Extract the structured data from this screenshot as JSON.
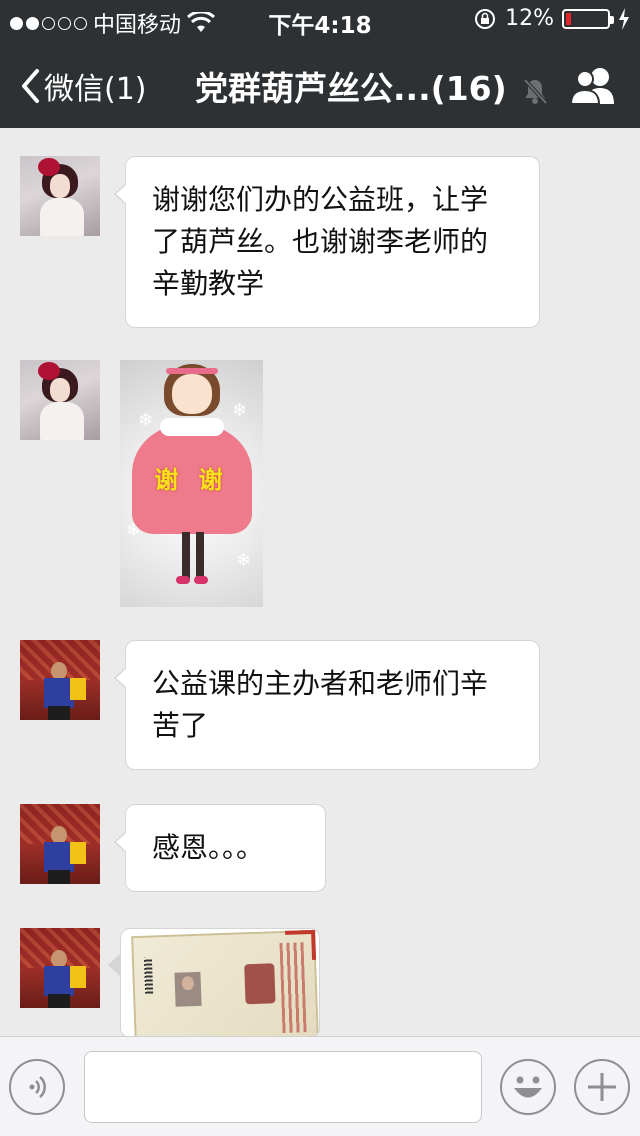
{
  "status_bar": {
    "carrier": "中国移动",
    "time": "下午4:18",
    "battery": "12%",
    "battery_level": 0.12
  },
  "nav": {
    "back_label": "微信(1)",
    "title": "党群葫芦丝公...(16)"
  },
  "messages": [
    {
      "type": "text",
      "sender": "woman",
      "text": "谢谢您们办的公益班，让学了葫芦丝。也谢谢李老师的辛勤教学"
    },
    {
      "type": "image",
      "sender": "woman",
      "sticker_text": "谢 谢"
    },
    {
      "type": "text",
      "sender": "man",
      "text": "公益课的主办者和老师们辛苦了"
    },
    {
      "type": "text",
      "sender": "man",
      "text": "感恩。。。"
    },
    {
      "type": "image",
      "sender": "man"
    }
  ],
  "icons": {
    "back": "chevron-left-icon",
    "mute": "bell-muted-icon",
    "members": "people-icon",
    "voice": "voice-icon",
    "emoji": "smiley-icon",
    "more": "plus-icon",
    "wifi": "wifi-icon",
    "rotation_lock": "rotation-lock-icon",
    "charging": "charging-icon"
  },
  "colors": {
    "nav_bg": "#2d3133",
    "chat_bg": "#ebebeb",
    "battery_low": "#e0262a"
  }
}
